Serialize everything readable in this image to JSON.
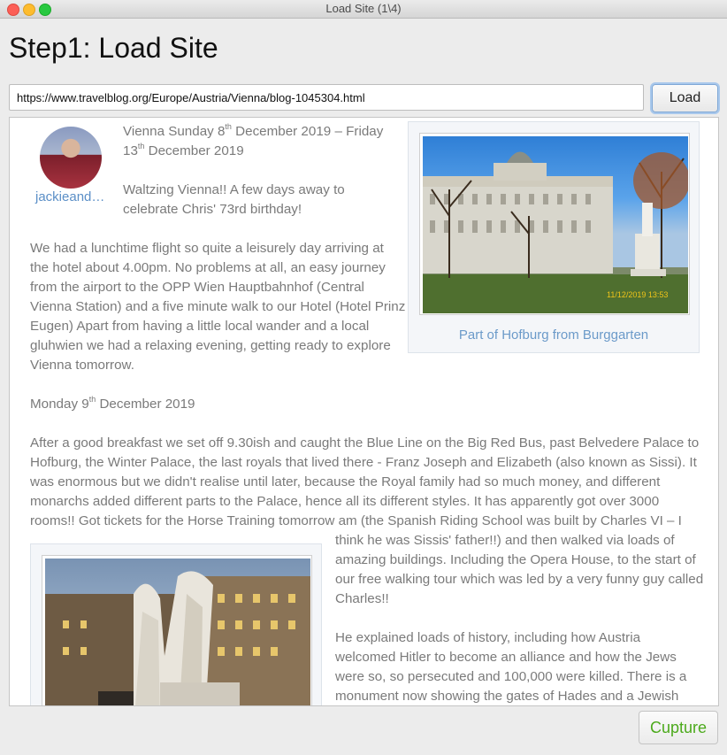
{
  "window": {
    "title": "Load Site (1\\4)"
  },
  "page": {
    "heading": "Step1: Load Site"
  },
  "url_bar": {
    "value": "https://www.travelblog.org/Europe/Austria/Vienna/blog-1045304.html",
    "load_label": "Load"
  },
  "blog": {
    "author": "jackieand…",
    "dates_pre": "Vienna Sunday 8",
    "dates_sup1": "th",
    "dates_mid": " December 2019 – Friday",
    "dates_line2_pre": "13",
    "dates_sup2": "th",
    "dates_line2_post": " December 2019",
    "intro_l1": "Waltzing Vienna!! A few days away to",
    "intro_l2": "celebrate Chris' 73rd birthday!",
    "p1_lines": [
      "We had a lunchtime flight so quite a leisurely day arriving at",
      "the hotel about 4.00pm. No problems at all, an easy journey",
      "from the airport to the OPP Wien Hauptbahnhof (Central",
      "Vienna Station) and a five minute walk to our Hotel (Hotel Prinz",
      "Eugen) Apart from having a little local wander and a local",
      "gluhwien we had a relaxing evening, getting ready to explore",
      "Vienna tomorrow."
    ],
    "monday_pre": "Monday 9",
    "monday_sup": "th",
    "monday_post": " December 2019",
    "p2_lines": [
      "After a good breakfast we set off 9.30ish and caught the Blue Line on the Big Red Bus, past Belvedere Palace to",
      "Hofburg, the Winter Palace, the last royals that lived there - Franz Joseph and Elizabeth (also known as Sissi). It",
      "was enormous but we didn't realise until later, because the Royal family had so much money, and different",
      "monarchs added different parts to the Palace, hence all its different styles. It has apparently got over 3000",
      "rooms!! Got tickets for the Horse Training tomorrow am (the Spanish Riding School was built by Charles VI –  I"
    ],
    "p3_lines": [
      "think he was Sissis' father!!) and then walked via loads of",
      "amazing buildings. Including the Opera House, to the start of",
      "our free walking tour which was led by a very funny guy called",
      "Charles!!"
    ],
    "p4_lines": [
      "He explained loads of history, including how Austria",
      "welcomed Hitler to become an alliance and how the Jews",
      "were so, so persecuted and 100,000 were killed. There is a",
      "monument now showing the gates of Hades and a Jewish"
    ],
    "photo1_caption": "Part of Hofburg from Burggarten",
    "photo1_stamp": "11/12/2019  13:53"
  },
  "footer": {
    "capture_label": "Cupture"
  },
  "colors": {
    "link": "#5b8fc7",
    "capture": "#4caa1c",
    "body_text": "#7a7a7a"
  }
}
